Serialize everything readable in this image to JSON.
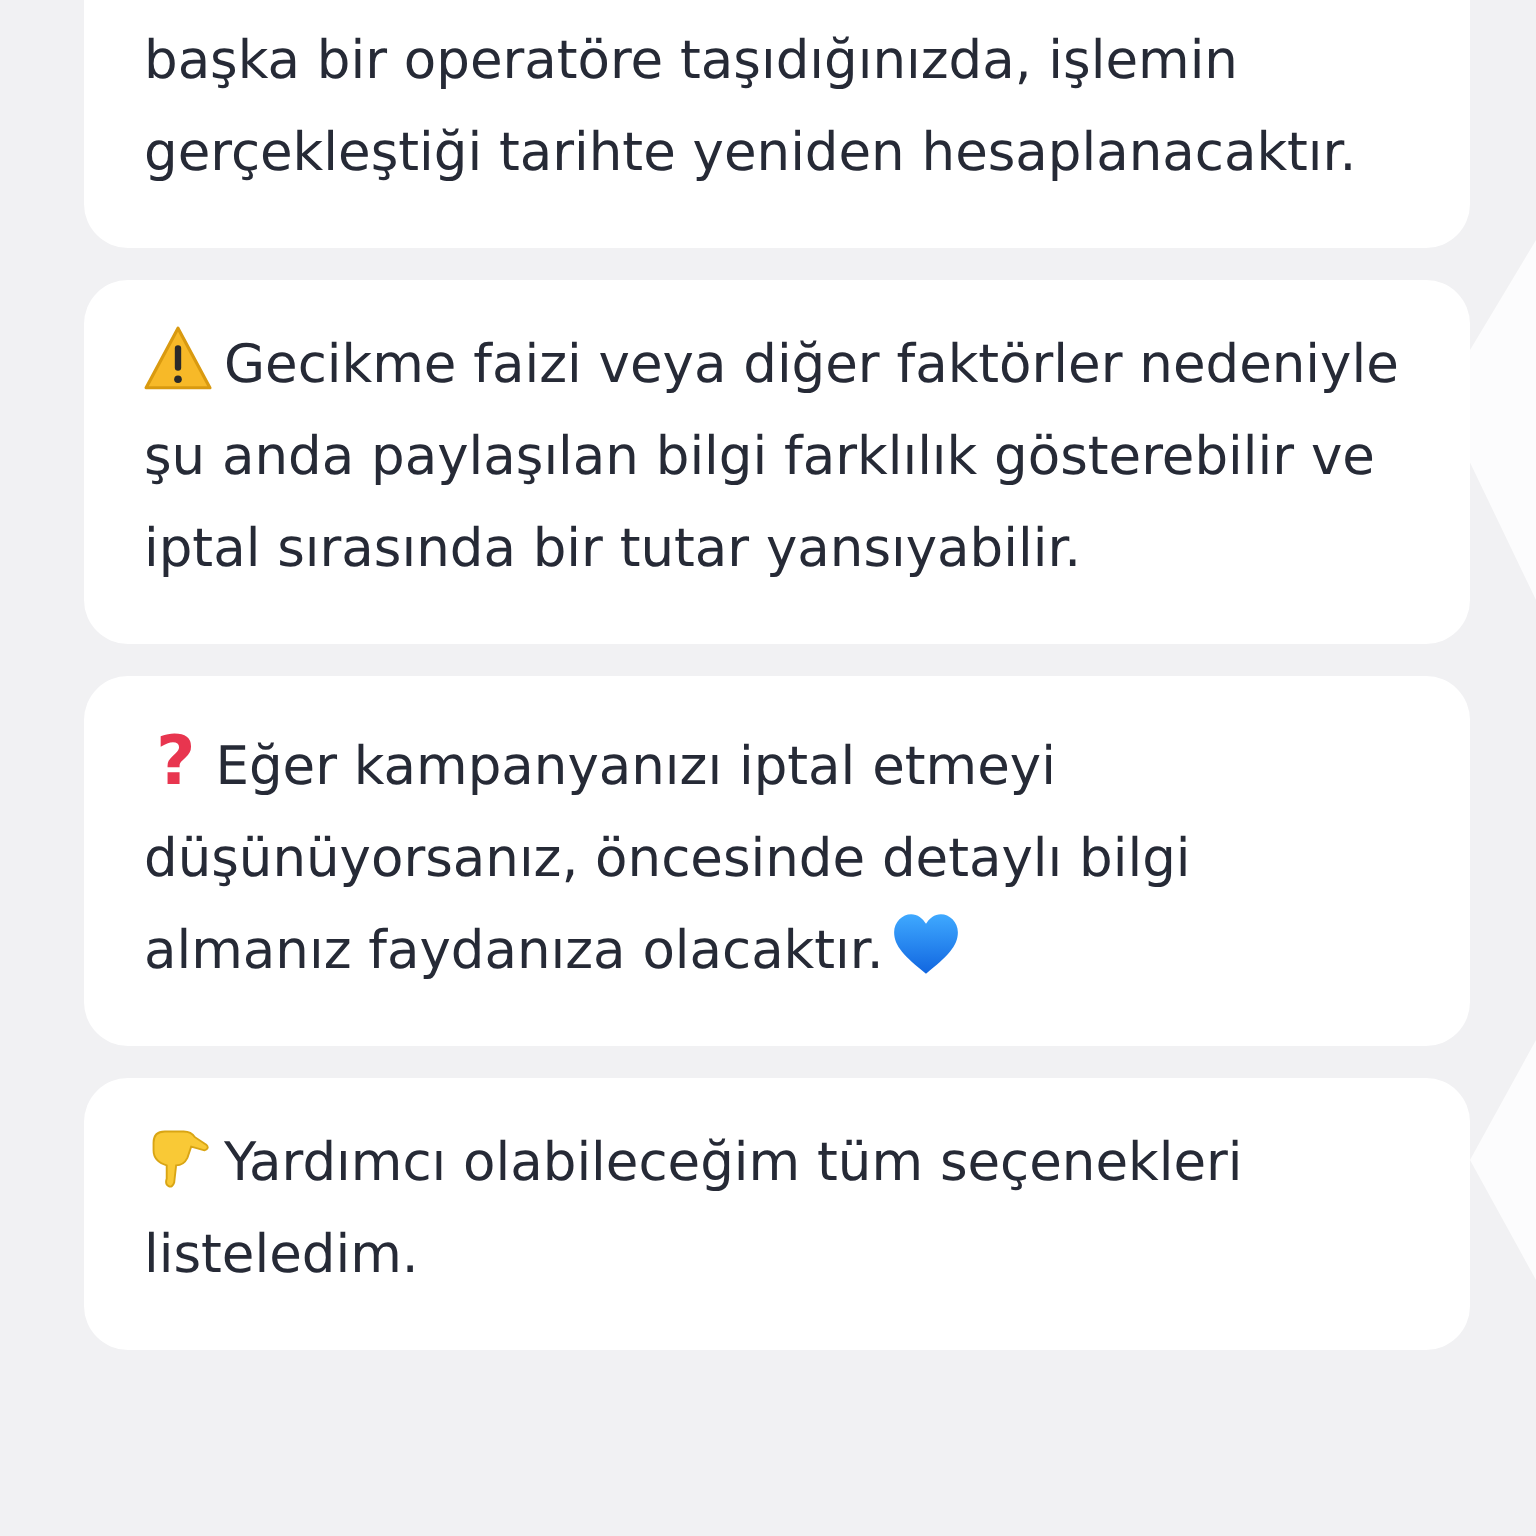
{
  "messages": [
    {
      "parts": [
        {
          "kind": "text",
          "text": "başka bir operatöre taşıdığınızda, işlemin gerçekleştiği tarihte yeniden hesaplanacaktır."
        }
      ]
    },
    {
      "parts": [
        {
          "kind": "warning"
        },
        {
          "kind": "text",
          "text": "Gecikme faizi veya diğer faktörler nedeniyle şu anda paylaşılan bilgi farklılık gösterebilir ve iptal sırasında bir tutar yansıyabilir."
        }
      ]
    },
    {
      "parts": [
        {
          "kind": "symbol",
          "text": "?"
        },
        {
          "kind": "text",
          "text": "Eğer kampanyanızı iptal etmeyi düşünüyorsanız, öncesinde detaylı bilgi almanız faydanıza olacaktır."
        },
        {
          "kind": "heart"
        }
      ]
    },
    {
      "parts": [
        {
          "kind": "pointing-hand"
        },
        {
          "kind": "text",
          "text": "Yardımcı olabileceğim tüm seçenekleri listeledim."
        }
      ]
    }
  ]
}
